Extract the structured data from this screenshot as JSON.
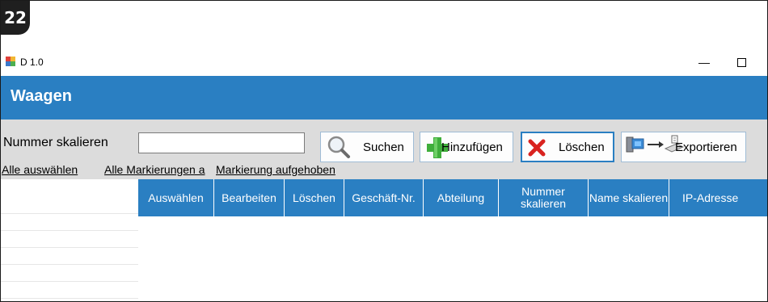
{
  "badge": "22",
  "window": {
    "title": "D 1.0"
  },
  "header": {
    "title": "Waagen"
  },
  "search": {
    "label": "Nummer skalieren",
    "value": "",
    "placeholder": ""
  },
  "buttons": {
    "search": "Suchen",
    "add": "Hinzufügen",
    "delete": "Löschen",
    "export": "Exportieren"
  },
  "links": {
    "select_all": "Alle auswählen",
    "all_marks": "Alle Markierungen a",
    "unmark": "Markierung aufgehoben"
  },
  "table": {
    "columns": [
      "Auswählen",
      "Bearbeiten",
      "Löschen",
      "Geschäft-Nr.",
      "Abteilung",
      "Nummer skalieren",
      "Name skalieren",
      "IP-Adresse"
    ],
    "rows": []
  },
  "colors": {
    "accent": "#2a7fc2",
    "toolbar": "#dcdcdc"
  }
}
